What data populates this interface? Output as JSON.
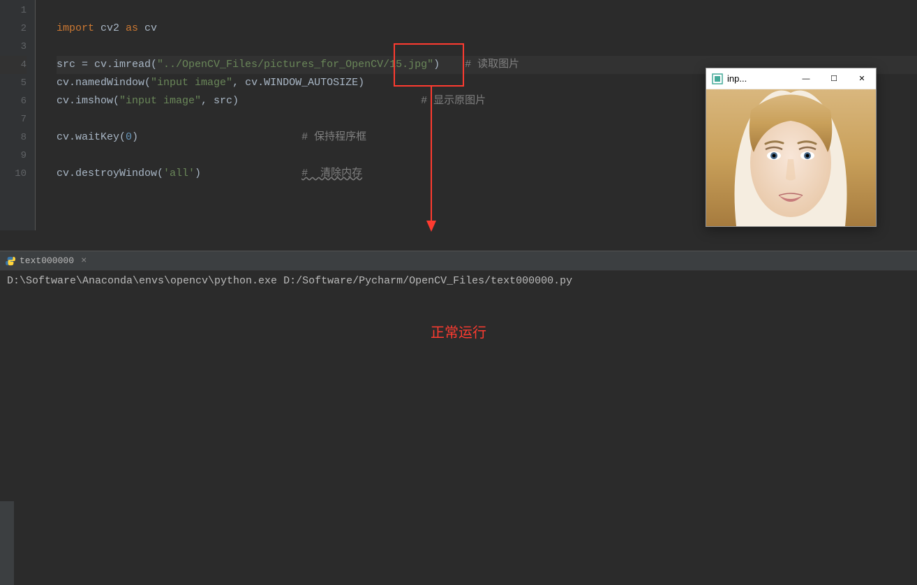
{
  "gutter": {
    "l1": "1",
    "l2": "2",
    "l3": "3",
    "l4": "4",
    "l5": "5",
    "l6": "6",
    "l7": "7",
    "l8": "8",
    "l9": "9",
    "l10": "10"
  },
  "code": {
    "l2": {
      "kw1": "import ",
      "mod": "cv2 ",
      "kw2": "as ",
      "alias": "cv"
    },
    "l4": {
      "a": "src = cv.imread(",
      "s": "\"../OpenCV_Files/pictures_for_OpenCV/15.jpg\"",
      "b": ")",
      "pad": "    ",
      "c": "# 读取图片"
    },
    "l5": {
      "a": "cv.namedWindow(",
      "s": "\"input image\"",
      "b": ", cv.WINDOW_AUTOSIZE)"
    },
    "l6": {
      "a": "cv.imshow(",
      "s": "\"input image\"",
      "b": ", src)",
      "pad": "                             ",
      "c": "# 显示原图片"
    },
    "l8": {
      "a": "cv.waitKey(",
      "n": "0",
      "b": ")",
      "pad": "                          ",
      "c": "# 保持程序框"
    },
    "l10": {
      "a": "cv.destroyWindow(",
      "s": "'all'",
      "b": ")",
      "pad": "                ",
      "c": "#  清除内存"
    }
  },
  "popup": {
    "title": "inp...",
    "min": "—",
    "max": "☐",
    "close": "✕"
  },
  "console": {
    "tab_name": "text000000",
    "tab_close": "×",
    "output": "D:\\Software\\Anaconda\\envs\\opencv\\python.exe D:/Software/Pycharm/OpenCV_Files/text000000.py"
  },
  "annotation": {
    "status": "正常运行"
  }
}
